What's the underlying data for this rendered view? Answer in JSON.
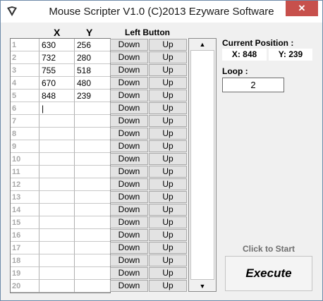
{
  "window": {
    "title": "Mouse Scripter V1.0 (C)2013 Ezyware Software",
    "close_label": "✕"
  },
  "grid": {
    "x_header": "X",
    "y_header": "Y",
    "button_header": "Left Button",
    "down_label": "Down",
    "up_label": "Up",
    "rows": [
      {
        "n": "1",
        "x": "630",
        "y": "256"
      },
      {
        "n": "2",
        "x": "732",
        "y": "280"
      },
      {
        "n": "3",
        "x": "755",
        "y": "518"
      },
      {
        "n": "4",
        "x": "670",
        "y": "480"
      },
      {
        "n": "5",
        "x": "848",
        "y": "239"
      },
      {
        "n": "6",
        "x": "|",
        "y": ""
      },
      {
        "n": "7",
        "x": "",
        "y": ""
      },
      {
        "n": "8",
        "x": "",
        "y": ""
      },
      {
        "n": "9",
        "x": "",
        "y": ""
      },
      {
        "n": "10",
        "x": "",
        "y": ""
      },
      {
        "n": "11",
        "x": "",
        "y": ""
      },
      {
        "n": "12",
        "x": "",
        "y": ""
      },
      {
        "n": "13",
        "x": "",
        "y": ""
      },
      {
        "n": "14",
        "x": "",
        "y": ""
      },
      {
        "n": "15",
        "x": "",
        "y": ""
      },
      {
        "n": "16",
        "x": "",
        "y": ""
      },
      {
        "n": "17",
        "x": "",
        "y": ""
      },
      {
        "n": "18",
        "x": "",
        "y": ""
      },
      {
        "n": "19",
        "x": "",
        "y": ""
      },
      {
        "n": "20",
        "x": "",
        "y": ""
      }
    ]
  },
  "scrollbar": {
    "up_arrow": "▲",
    "down_arrow": "▼"
  },
  "position": {
    "label": "Current Position :",
    "x_text": "X: 848",
    "y_text": "Y: 239"
  },
  "loop": {
    "label": "Loop :",
    "value": "2"
  },
  "execute": {
    "hint": "Click to Start",
    "label": "Execute"
  }
}
